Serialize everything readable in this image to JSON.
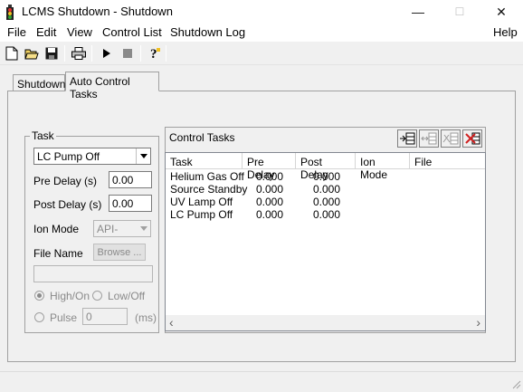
{
  "window": {
    "title": "LCMS Shutdown - Shutdown",
    "minimize": "—",
    "maximize": "☐",
    "close": "✕"
  },
  "menu": {
    "file": "File",
    "edit": "Edit",
    "view": "View",
    "control_list": "Control List",
    "shutdown_log": "Shutdown Log",
    "help": "Help"
  },
  "tabs": {
    "shutdown": "Shutdown",
    "auto_control": "Auto Control Tasks"
  },
  "task_group": {
    "title": "Task",
    "task_value": "LC Pump Off",
    "pre_delay_label": "Pre Delay (s)",
    "pre_delay_value": "0.00",
    "post_delay_label": "Post Delay (s)",
    "post_delay_value": "0.00",
    "ion_mode_label": "Ion Mode",
    "ion_mode_value": "API-",
    "file_name_label": "File Name",
    "browse_label": "Browse ...",
    "file_name_value": "",
    "high_on_label": "High/On",
    "low_off_label": "Low/Off",
    "pulse_label": "Pulse",
    "pulse_value": "0",
    "pulse_unit": "(ms)"
  },
  "control_tasks": {
    "title": "Control Tasks",
    "columns": [
      "Task",
      "Pre Delay",
      "Post Delay",
      "Ion Mode",
      "File"
    ],
    "rows": [
      {
        "task": "Helium Gas Off",
        "pre": "0.000",
        "post": "0.000"
      },
      {
        "task": "Source Standby",
        "pre": "0.000",
        "post": "0.000"
      },
      {
        "task": "UV Lamp Off",
        "pre": "0.000",
        "post": "0.000"
      },
      {
        "task": "LC Pump Off",
        "pre": "0.000",
        "post": "0.000"
      }
    ],
    "scroll_left": "‹",
    "scroll_right": "›"
  }
}
